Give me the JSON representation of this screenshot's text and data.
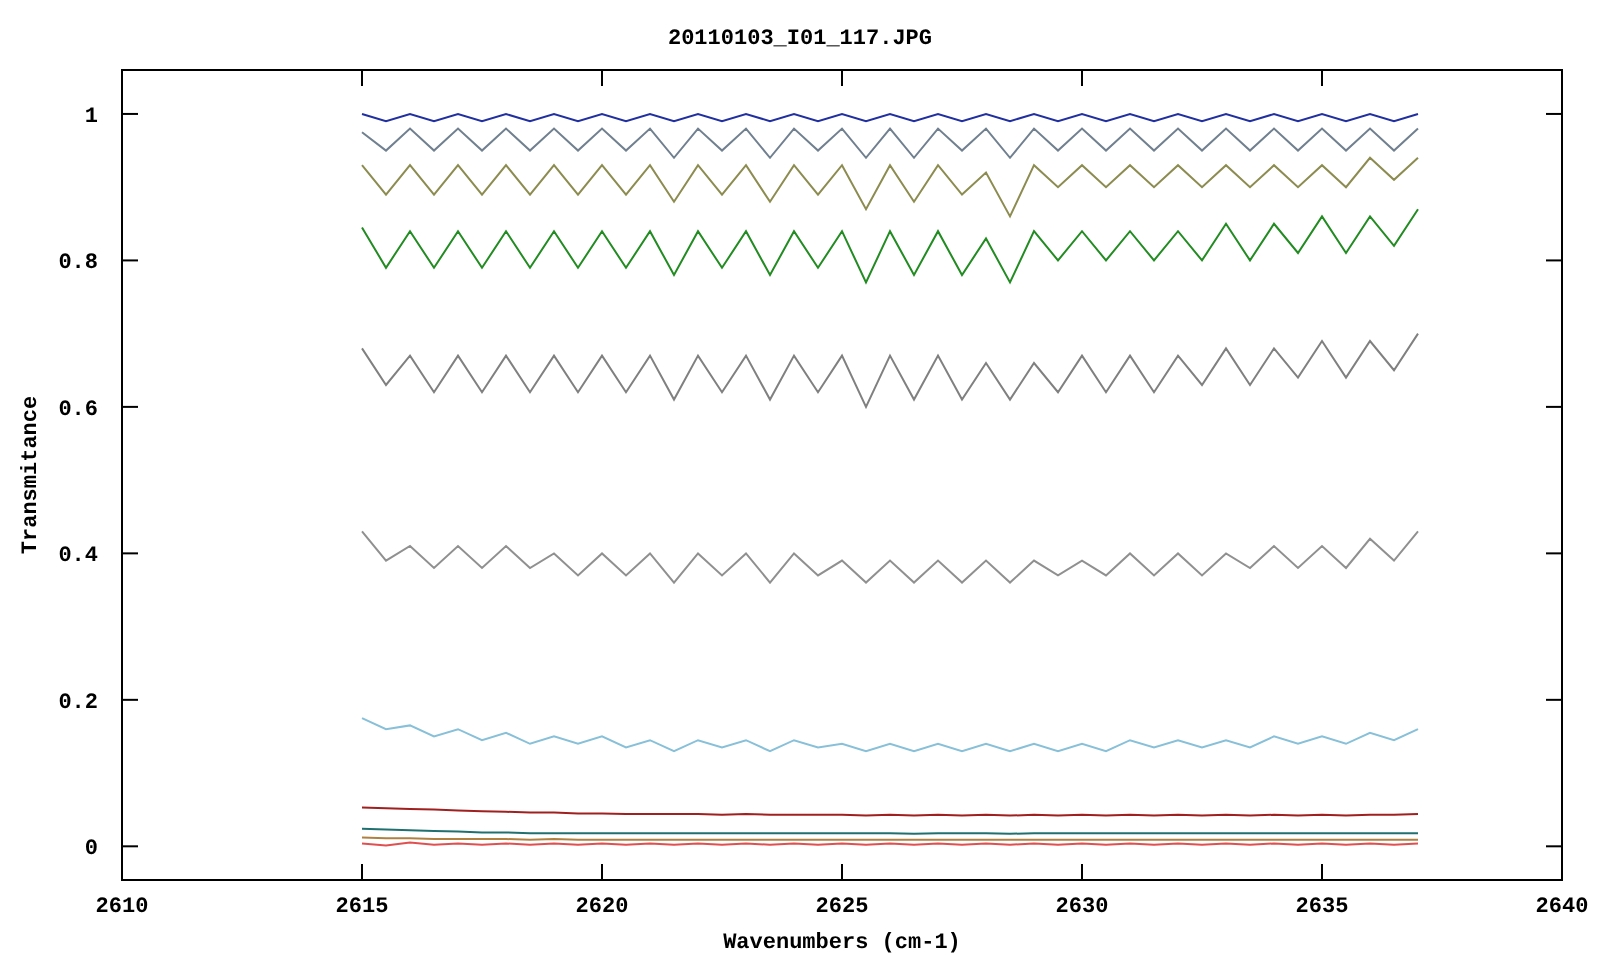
{
  "chart_data": {
    "type": "line",
    "title": "20110103_I01_117.JPG",
    "xlabel": "Wavenumbers (cm-1)",
    "ylabel": "Transmitance",
    "x": [
      2615,
      2615.5,
      2616,
      2616.5,
      2617,
      2617.5,
      2618,
      2618.5,
      2619,
      2619.5,
      2620,
      2620.5,
      2621,
      2621.5,
      2622,
      2622.5,
      2623,
      2623.5,
      2624,
      2624.5,
      2625,
      2625.5,
      2626,
      2626.5,
      2627,
      2627.5,
      2628,
      2628.5,
      2629,
      2629.5,
      2630,
      2630.5,
      2631,
      2631.5,
      2632,
      2632.5,
      2633,
      2633.5,
      2634,
      2634.5,
      2635,
      2635.5,
      2636,
      2636.5,
      2637
    ],
    "xlim": [
      2610,
      2640
    ],
    "ylim": [
      -0.046,
      1.06
    ],
    "xticks": [
      2610,
      2615,
      2620,
      2625,
      2630,
      2635,
      2640
    ],
    "yticks": [
      0,
      0.2,
      0.4,
      0.6,
      0.8,
      1
    ],
    "series": [
      {
        "color": "#2030a0",
        "values": [
          1,
          0.99,
          1,
          0.99,
          1,
          0.99,
          1,
          0.99,
          1,
          0.99,
          1,
          0.99,
          1,
          0.99,
          1,
          0.99,
          1,
          0.99,
          1,
          0.99,
          1,
          0.99,
          1,
          0.99,
          1,
          0.99,
          1,
          0.99,
          1,
          0.99,
          1,
          0.99,
          1,
          0.99,
          1,
          0.99,
          1,
          0.99,
          1,
          0.99,
          1,
          0.99,
          1,
          0.99,
          1
        ]
      },
      {
        "color": "#708090",
        "values": [
          0.975,
          0.95,
          0.98,
          0.95,
          0.98,
          0.95,
          0.98,
          0.95,
          0.98,
          0.95,
          0.98,
          0.95,
          0.98,
          0.94,
          0.98,
          0.95,
          0.98,
          0.94,
          0.98,
          0.95,
          0.98,
          0.94,
          0.98,
          0.94,
          0.98,
          0.95,
          0.98,
          0.94,
          0.98,
          0.95,
          0.98,
          0.95,
          0.98,
          0.95,
          0.98,
          0.95,
          0.98,
          0.95,
          0.98,
          0.95,
          0.98,
          0.95,
          0.98,
          0.95,
          0.98
        ]
      },
      {
        "color": "#8c8c50",
        "values": [
          0.93,
          0.89,
          0.93,
          0.89,
          0.93,
          0.89,
          0.93,
          0.89,
          0.93,
          0.89,
          0.93,
          0.89,
          0.93,
          0.88,
          0.93,
          0.89,
          0.93,
          0.88,
          0.93,
          0.89,
          0.93,
          0.87,
          0.93,
          0.88,
          0.93,
          0.89,
          0.92,
          0.86,
          0.93,
          0.9,
          0.93,
          0.9,
          0.93,
          0.9,
          0.93,
          0.9,
          0.93,
          0.9,
          0.93,
          0.9,
          0.93,
          0.9,
          0.94,
          0.91,
          0.94
        ]
      },
      {
        "color": "#228b22",
        "values": [
          0.845,
          0.79,
          0.84,
          0.79,
          0.84,
          0.79,
          0.84,
          0.79,
          0.84,
          0.79,
          0.84,
          0.79,
          0.84,
          0.78,
          0.84,
          0.79,
          0.84,
          0.78,
          0.84,
          0.79,
          0.84,
          0.77,
          0.84,
          0.78,
          0.84,
          0.78,
          0.83,
          0.77,
          0.84,
          0.8,
          0.84,
          0.8,
          0.84,
          0.8,
          0.84,
          0.8,
          0.85,
          0.8,
          0.85,
          0.81,
          0.86,
          0.81,
          0.86,
          0.82,
          0.87
        ]
      },
      {
        "color": "#808080",
        "values": [
          0.68,
          0.63,
          0.67,
          0.62,
          0.67,
          0.62,
          0.67,
          0.62,
          0.67,
          0.62,
          0.67,
          0.62,
          0.67,
          0.61,
          0.67,
          0.62,
          0.67,
          0.61,
          0.67,
          0.62,
          0.67,
          0.6,
          0.67,
          0.61,
          0.67,
          0.61,
          0.66,
          0.61,
          0.66,
          0.62,
          0.67,
          0.62,
          0.67,
          0.62,
          0.67,
          0.63,
          0.68,
          0.63,
          0.68,
          0.64,
          0.69,
          0.64,
          0.69,
          0.65,
          0.7
        ]
      },
      {
        "color": "#909090",
        "values": [
          0.43,
          0.39,
          0.41,
          0.38,
          0.41,
          0.38,
          0.41,
          0.38,
          0.4,
          0.37,
          0.4,
          0.37,
          0.4,
          0.36,
          0.4,
          0.37,
          0.4,
          0.36,
          0.4,
          0.37,
          0.39,
          0.36,
          0.39,
          0.36,
          0.39,
          0.36,
          0.39,
          0.36,
          0.39,
          0.37,
          0.39,
          0.37,
          0.4,
          0.37,
          0.4,
          0.37,
          0.4,
          0.38,
          0.41,
          0.38,
          0.41,
          0.38,
          0.42,
          0.39,
          0.43
        ]
      },
      {
        "color": "#87c0d8",
        "values": [
          0.175,
          0.16,
          0.165,
          0.15,
          0.16,
          0.145,
          0.155,
          0.14,
          0.15,
          0.14,
          0.15,
          0.135,
          0.145,
          0.13,
          0.145,
          0.135,
          0.145,
          0.13,
          0.145,
          0.135,
          0.14,
          0.13,
          0.14,
          0.13,
          0.14,
          0.13,
          0.14,
          0.13,
          0.14,
          0.13,
          0.14,
          0.13,
          0.145,
          0.135,
          0.145,
          0.135,
          0.145,
          0.135,
          0.15,
          0.14,
          0.15,
          0.14,
          0.155,
          0.145,
          0.16
        ]
      },
      {
        "color": "#a02020",
        "values": [
          0.053,
          0.052,
          0.051,
          0.05,
          0.049,
          0.048,
          0.047,
          0.046,
          0.046,
          0.045,
          0.045,
          0.044,
          0.044,
          0.044,
          0.044,
          0.043,
          0.044,
          0.043,
          0.043,
          0.043,
          0.043,
          0.042,
          0.043,
          0.042,
          0.043,
          0.042,
          0.043,
          0.042,
          0.043,
          0.042,
          0.043,
          0.042,
          0.043,
          0.042,
          0.043,
          0.042,
          0.043,
          0.042,
          0.043,
          0.042,
          0.043,
          0.042,
          0.043,
          0.043,
          0.044
        ]
      },
      {
        "color": "#207070",
        "values": [
          0.024,
          0.023,
          0.022,
          0.021,
          0.02,
          0.019,
          0.019,
          0.018,
          0.018,
          0.018,
          0.018,
          0.018,
          0.018,
          0.018,
          0.018,
          0.018,
          0.018,
          0.018,
          0.018,
          0.018,
          0.018,
          0.018,
          0.018,
          0.017,
          0.018,
          0.018,
          0.018,
          0.017,
          0.018,
          0.018,
          0.018,
          0.018,
          0.018,
          0.018,
          0.018,
          0.018,
          0.018,
          0.018,
          0.018,
          0.018,
          0.018,
          0.018,
          0.018,
          0.018,
          0.018
        ]
      },
      {
        "color": "#b08040",
        "values": [
          0.012,
          0.011,
          0.011,
          0.01,
          0.01,
          0.01,
          0.01,
          0.009,
          0.01,
          0.009,
          0.009,
          0.009,
          0.009,
          0.009,
          0.009,
          0.009,
          0.009,
          0.009,
          0.009,
          0.009,
          0.009,
          0.009,
          0.009,
          0.009,
          0.009,
          0.009,
          0.009,
          0.009,
          0.009,
          0.009,
          0.009,
          0.009,
          0.009,
          0.009,
          0.009,
          0.009,
          0.009,
          0.009,
          0.009,
          0.009,
          0.009,
          0.009,
          0.009,
          0.009,
          0.009
        ]
      },
      {
        "color": "#e05050",
        "values": [
          0.004,
          0.001,
          0.005,
          0.002,
          0.004,
          0.002,
          0.004,
          0.002,
          0.004,
          0.002,
          0.004,
          0.002,
          0.004,
          0.002,
          0.004,
          0.002,
          0.004,
          0.002,
          0.004,
          0.002,
          0.004,
          0.002,
          0.004,
          0.002,
          0.004,
          0.002,
          0.004,
          0.002,
          0.004,
          0.002,
          0.004,
          0.002,
          0.004,
          0.002,
          0.004,
          0.002,
          0.004,
          0.002,
          0.004,
          0.002,
          0.004,
          0.002,
          0.004,
          0.002,
          0.004
        ]
      }
    ]
  }
}
